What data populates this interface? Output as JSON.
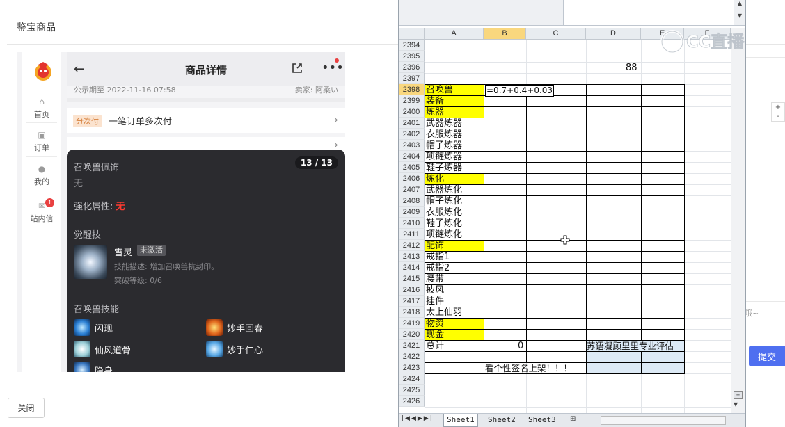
{
  "dialog": {
    "title": "鉴宝商品",
    "close_label": "关闭",
    "submit_label": "提交",
    "right_hint": "哦~"
  },
  "phone": {
    "nav": [
      {
        "label": "首页",
        "icon": "home-icon"
      },
      {
        "label": "订单",
        "icon": "order-icon"
      },
      {
        "label": "我的",
        "icon": "user-icon"
      },
      {
        "label": "站内信",
        "icon": "mail-icon",
        "badge": "1"
      }
    ],
    "header": {
      "title": "商品详情"
    },
    "notice_date": "公示期至 2022-11-16 07:58",
    "seller": "卖家: 阿柔い",
    "pay_tag": "分次付",
    "pay_text": "一笔订单多次付",
    "overlay": {
      "counter": "13 / 13",
      "ornament_label": "召唤兽佩饰",
      "ornament_value": "无",
      "enhance_label": "强化属性:",
      "enhance_value": "无",
      "awaken_label": "觉醒技",
      "skill_name": "雪灵",
      "skill_tag": "未激活",
      "skill_desc": "技能描述: 增加召唤兽抗封印。",
      "skill_level": "突破等级: 0/6",
      "pet_skills_label": "召唤兽技能",
      "pet_skills": [
        "闪现",
        "妙手回春",
        "仙风道骨",
        "妙手仁心",
        "隐身"
      ]
    }
  },
  "excel": {
    "columns": [
      "A",
      "B",
      "C",
      "D",
      "E",
      "F"
    ],
    "rows": [
      "2394",
      "2395",
      "2396",
      "2397",
      "2398",
      "2399",
      "2400",
      "2401",
      "2402",
      "2403",
      "2404",
      "2405",
      "2406",
      "2407",
      "2408",
      "2409",
      "2410",
      "2411",
      "2412",
      "2413",
      "2414",
      "2415",
      "2416",
      "2417",
      "2418",
      "2419",
      "2420",
      "2421",
      "2422",
      "2423",
      "2424",
      "2425",
      "2426"
    ],
    "colA": [
      "",
      "",
      "",
      "",
      "召唤兽",
      "装备",
      "炼器",
      "武器炼器",
      "衣服炼器",
      "帽子炼器",
      "项链炼器",
      "鞋子炼器",
      "炼化",
      "武器炼化",
      "帽子炼化",
      "衣服炼化",
      "鞋子炼化",
      "项链炼化",
      "配饰",
      "戒指1",
      "戒指2",
      "腰带",
      "披风",
      "挂件",
      "太上仙羽",
      "物资",
      "现金",
      "总计",
      "",
      ""
    ],
    "d2396": "88",
    "b2398": "=0.7+0.4+0.03",
    "b2421": "0",
    "d2421": "苏语凝顾里里专业评估",
    "b2423": "看个性签名上架！！！",
    "sheets": [
      "Sheet1",
      "Sheet2",
      "Sheet3"
    ],
    "active_sheet": "Sheet1"
  },
  "colors": {
    "highlight_yellow": "#ffff00",
    "selected_header": "#f9d77e",
    "submit_blue": "#4f6ff0",
    "dark_card": "#2b2b2f",
    "red": "#ff3b30"
  }
}
